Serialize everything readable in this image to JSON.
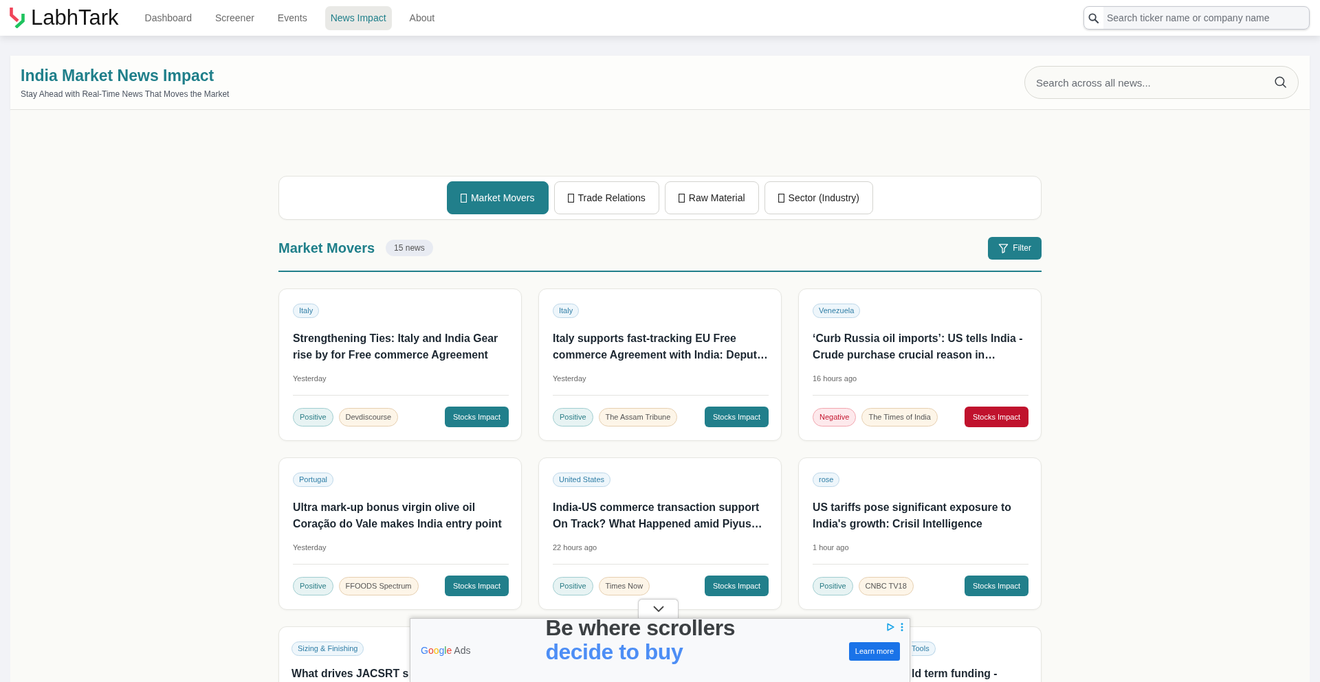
{
  "nav": {
    "brand": "LabhTark",
    "items": [
      {
        "label": "Dashboard",
        "selected": false
      },
      {
        "label": "Screener",
        "selected": false
      },
      {
        "label": "Events",
        "selected": false
      },
      {
        "label": "News Impact",
        "selected": true
      },
      {
        "label": "About",
        "selected": false
      }
    ],
    "search": {
      "placeholder": "Search ticker name or company name"
    }
  },
  "header": {
    "title": "India Market News Impact",
    "subtitle": "Stay Ahead with Real-Time News That Moves the Market",
    "search": {
      "placeholder": "Search across all news..."
    }
  },
  "category_tabs": [
    {
      "label": "Market Movers",
      "selected": true
    },
    {
      "label": "Trade Relations",
      "selected": false
    },
    {
      "label": "Raw Material",
      "selected": false
    },
    {
      "label": "Sector (Industry)",
      "selected": false
    }
  ],
  "section": {
    "title": "Market Movers",
    "count": "15 news",
    "filter_button": "Filter"
  },
  "cards": [
    {
      "tag": "Italy",
      "title": "Strengthening Ties: Italy and India Gear rise by for Free commerce Agreement",
      "time": "Yesterday",
      "sentiment": "Positive",
      "negative": false,
      "source": "Devdiscourse",
      "action": "Stocks Impact"
    },
    {
      "tag": "Italy",
      "title": "Italy supports fast-tracking EU Free commerce Agreement with India: Deput…",
      "time": "Yesterday",
      "sentiment": "Positive",
      "negative": false,
      "source": "The Assam Tribune",
      "action": "Stocks Impact"
    },
    {
      "tag": "Venezuela",
      "title": "‘Curb Russia oil imports’: US tells India - Crude purchase crucial reason in…",
      "time": "16 hours ago",
      "sentiment": "Negative",
      "negative": true,
      "source": "The Times of India",
      "action": "Stocks Impact"
    },
    {
      "tag": "Portugal",
      "title": "Ultra mark-up bonus virgin olive oil Coração do Vale makes India entry point",
      "time": "Yesterday",
      "sentiment": "Positive",
      "negative": false,
      "source": "FFOODS Spectrum",
      "action": "Stocks Impact"
    },
    {
      "tag": "United States",
      "title": "India-US commerce transaction support On Track? What Happened amid Piyus…",
      "time": "22 hours ago",
      "sentiment": "Positive",
      "negative": false,
      "source": "Times Now",
      "action": "Stocks Impact"
    },
    {
      "tag": "rose",
      "title": "US tariffs pose significant exposure to India's growth: Crisil Intelligence",
      "time": "1 hour ago",
      "sentiment": "Positive",
      "negative": false,
      "source": "CNBC TV18",
      "action": "Stocks Impact"
    }
  ],
  "covered_cards": [
    {
      "tag": "Sizing & Finishing",
      "title": "What drives JACSRT s"
    },
    {
      "tag": "Tools",
      "title": "ld term funding -"
    }
  ],
  "ad": {
    "brand": "Google Ads",
    "headline": [
      "Be where scrollers",
      "decide to buy"
    ],
    "button": "Learn more"
  }
}
